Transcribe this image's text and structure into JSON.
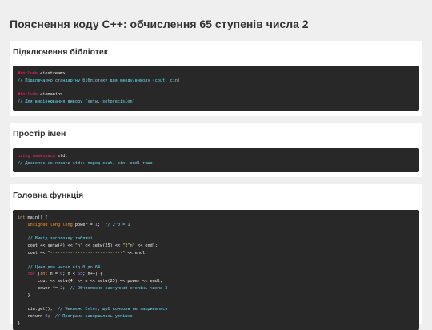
{
  "page": {
    "title": "Пояснення коду C++: обчислення 65 ступенів числа 2"
  },
  "sections": {
    "includes": {
      "heading": "Підключення бібліотек",
      "lines": [
        [
          {
            "t": "#include",
            "c": "pp"
          },
          {
            "t": " <iostream>",
            "c": ""
          }
        ],
        [
          {
            "t": "// Підключаємо стандартну бібліотеку для вводу/виводу (cout, cin)",
            "c": "cmt"
          }
        ],
        [],
        [
          {
            "t": "#include",
            "c": "pp"
          },
          {
            "t": " <iomanip>",
            "c": ""
          }
        ],
        [
          {
            "t": "// Для вирівнювання виводу (setw, setprecision)",
            "c": "cmt"
          }
        ]
      ]
    },
    "namespace": {
      "heading": "Простір імен",
      "lines": [
        [
          {
            "t": "using",
            "c": "kw"
          },
          {
            "t": " ",
            "c": ""
          },
          {
            "t": "namespace",
            "c": "kw"
          },
          {
            "t": " std;",
            "c": ""
          }
        ],
        [
          {
            "t": "// Дозволяє не писати std:: перед cout, cin, endl тощо",
            "c": "cmt"
          }
        ]
      ]
    },
    "main": {
      "heading": "Головна функція",
      "lines": [
        [
          {
            "t": "int",
            "c": "typ"
          },
          {
            "t": " main() {",
            "c": ""
          }
        ],
        [
          {
            "t": "    ",
            "c": ""
          },
          {
            "t": "unsigned long long",
            "c": "typ"
          },
          {
            "t": " power = ",
            "c": ""
          },
          {
            "t": "1",
            "c": "num"
          },
          {
            "t": ";  ",
            "c": ""
          },
          {
            "t": "// 2^0 = 1",
            "c": "cmt"
          }
        ],
        [],
        [
          {
            "t": "    ",
            "c": ""
          },
          {
            "t": "// Вивід заголовку таблиці",
            "c": "cmt"
          }
        ],
        [
          {
            "t": "    cout << setw(4) << ",
            "c": ""
          },
          {
            "t": "\"n\"",
            "c": "str"
          },
          {
            "t": " << setw(25) << ",
            "c": ""
          },
          {
            "t": "\"2^n\"",
            "c": "str"
          },
          {
            "t": " << endl;",
            "c": ""
          }
        ],
        [
          {
            "t": "    cout << ",
            "c": ""
          },
          {
            "t": "\"-----------------------------\"",
            "c": "str"
          },
          {
            "t": " << endl;",
            "c": ""
          }
        ],
        [],
        [
          {
            "t": "    ",
            "c": ""
          },
          {
            "t": "// Цикл для чисел від 0 до 64",
            "c": "cmt"
          }
        ],
        [
          {
            "t": "    ",
            "c": ""
          },
          {
            "t": "for",
            "c": "kw"
          },
          {
            "t": " (",
            "c": ""
          },
          {
            "t": "int",
            "c": "typ"
          },
          {
            "t": " n = ",
            "c": ""
          },
          {
            "t": "0",
            "c": "num"
          },
          {
            "t": "; n < ",
            "c": ""
          },
          {
            "t": "65",
            "c": "num"
          },
          {
            "t": "; n++) {",
            "c": ""
          }
        ],
        [
          {
            "t": "        cout << setw(4) << n << setw(25) << power << endl;",
            "c": ""
          }
        ],
        [
          {
            "t": "        power *= ",
            "c": ""
          },
          {
            "t": "2",
            "c": "num"
          },
          {
            "t": ";  ",
            "c": ""
          },
          {
            "t": "// Обчислюємо наступний степінь числа 2",
            "c": "cmt"
          }
        ],
        [
          {
            "t": "    }",
            "c": ""
          }
        ],
        [],
        [
          {
            "t": "    cin.get();  ",
            "c": ""
          },
          {
            "t": "// Чекаємо Enter, щоб консоль не закривалася",
            "c": "cmt"
          }
        ],
        [
          {
            "t": "    return ",
            "c": ""
          },
          {
            "t": "0",
            "c": "num"
          },
          {
            "t": ";  ",
            "c": ""
          },
          {
            "t": "// Програма завершилась успішно",
            "c": "cmt"
          }
        ],
        [
          {
            "t": "}",
            "c": ""
          }
        ]
      ]
    }
  }
}
